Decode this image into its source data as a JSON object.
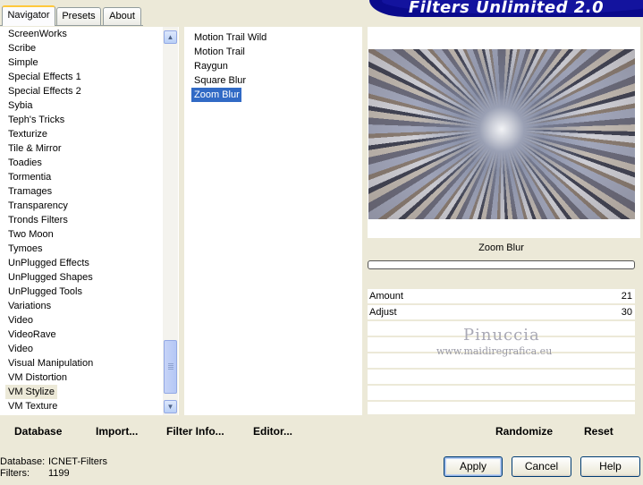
{
  "tabs": [
    {
      "label": "Navigator",
      "active": true
    },
    {
      "label": "Presets",
      "active": false
    },
    {
      "label": "About",
      "active": false
    }
  ],
  "title": "Filters Unlimited 2.0",
  "categories": [
    "ScreenWorks",
    "Scribe",
    "Simple",
    "Special Effects 1",
    "Special Effects 2",
    "Sybia",
    "Teph's Tricks",
    "Texturize",
    "Tile & Mirror",
    "Toadies",
    "Tormentia",
    "Tramages",
    "Transparency",
    "Tronds Filters",
    "Two Moon",
    "Tymoes",
    "UnPlugged Effects",
    "UnPlugged Shapes",
    "UnPlugged Tools",
    "Variations",
    "Video",
    "VideoRave",
    "Video",
    "Visual Manipulation",
    "VM Distortion",
    "VM Stylize",
    "VM Texture"
  ],
  "selected_category": "VM Stylize",
  "filters": [
    "Motion Trail Wild",
    "Motion Trail",
    "Raygun",
    "Square Blur",
    "Zoom Blur"
  ],
  "selected_filter": "Zoom Blur",
  "toolbar": {
    "database": "Database",
    "import": "Import...",
    "filter_info": "Filter Info...",
    "editor": "Editor...",
    "randomize": "Randomize",
    "reset": "Reset"
  },
  "preview": {
    "filter_name": "Zoom Blur",
    "progress": 0
  },
  "params": [
    {
      "label": "Amount",
      "value": "21"
    },
    {
      "label": "Adjust",
      "value": "30"
    }
  ],
  "watermark": {
    "name": "Pinuccia",
    "site": "www.maidiregrafica.eu"
  },
  "status": {
    "database_label": "Database:",
    "database_value": "ICNET-Filters",
    "filters_label": "Filters:",
    "filters_value": "1199"
  },
  "buttons": {
    "apply": "Apply",
    "cancel": "Cancel",
    "help": "Help"
  },
  "colors": {
    "accent": "#316ac5",
    "banner": "#0a0a8c",
    "face": "#ece9d8"
  }
}
